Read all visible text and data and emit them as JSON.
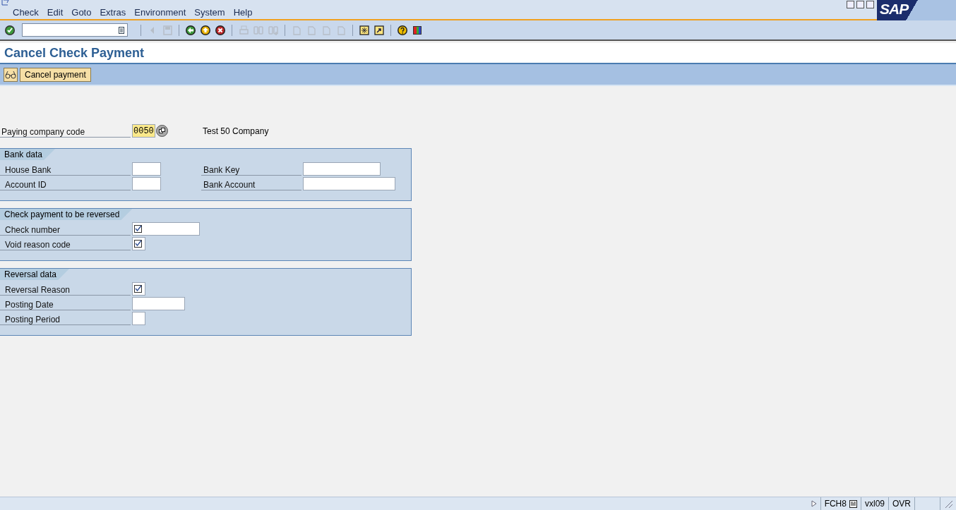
{
  "menu": [
    "Check",
    "Edit",
    "Goto",
    "Extras",
    "Environment",
    "System",
    "Help"
  ],
  "logo": "SAP",
  "toolbar": [
    {
      "kind": "enter",
      "disabled": false
    },
    {
      "kind": "command"
    },
    {
      "kind": "sep"
    },
    {
      "kind": "prev",
      "disabled": true
    },
    {
      "kind": "save",
      "disabled": true
    },
    {
      "kind": "sep"
    },
    {
      "kind": "back",
      "disabled": false
    },
    {
      "kind": "exit",
      "disabled": false
    },
    {
      "kind": "cancel",
      "disabled": false
    },
    {
      "kind": "sep"
    },
    {
      "kind": "print",
      "disabled": true
    },
    {
      "kind": "find",
      "disabled": true
    },
    {
      "kind": "findnext",
      "disabled": true
    },
    {
      "kind": "sep"
    },
    {
      "kind": "page",
      "disabled": true
    },
    {
      "kind": "page",
      "disabled": true
    },
    {
      "kind": "page",
      "disabled": true
    },
    {
      "kind": "page",
      "disabled": true
    },
    {
      "kind": "sep"
    },
    {
      "kind": "session",
      "disabled": false
    },
    {
      "kind": "shortcut",
      "disabled": false
    },
    {
      "kind": "sep"
    },
    {
      "kind": "help",
      "disabled": false
    },
    {
      "kind": "layout",
      "disabled": false
    }
  ],
  "title": "Cancel Check Payment",
  "app_toolbar": {
    "button": "Cancel payment"
  },
  "company": {
    "label": "Paying company code",
    "value": "0050",
    "description": "Test 50 Company"
  },
  "groups": [
    {
      "title": "Bank data",
      "rows": [
        [
          {
            "label": "House Bank",
            "required": false
          },
          {
            "label": "Bank Key",
            "required": false
          }
        ],
        [
          {
            "label": "Account ID",
            "required": false
          },
          {
            "label": "Bank Account",
            "required": false
          }
        ]
      ]
    },
    {
      "title": "Check payment to be reversed",
      "rows": [
        [
          {
            "label": "Check number",
            "required": true
          }
        ],
        [
          {
            "label": "Void reason code",
            "required": true
          }
        ]
      ]
    },
    {
      "title": "Reversal data",
      "rows": [
        [
          {
            "label": "Reversal Reason",
            "required": true
          }
        ],
        [
          {
            "label": "Posting Date",
            "required": false
          }
        ],
        [
          {
            "label": "Posting Period",
            "required": false
          }
        ]
      ]
    }
  ],
  "status_bar": {
    "transaction": "FCH8",
    "server": "vxl09",
    "mode": "OVR"
  }
}
